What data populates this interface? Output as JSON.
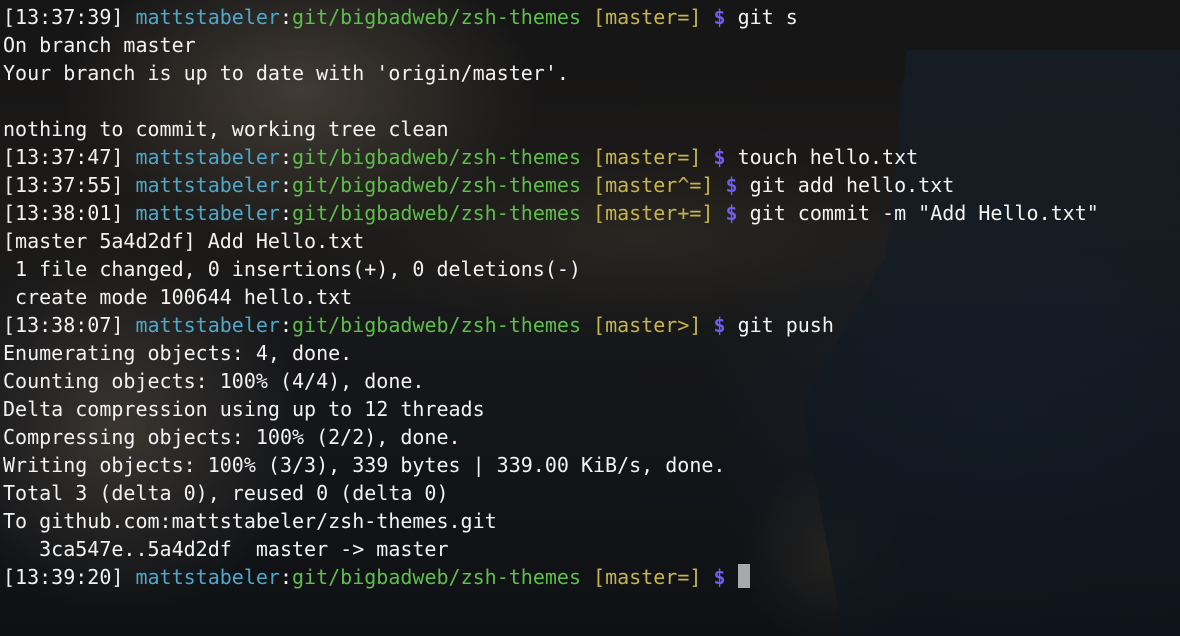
{
  "colors": {
    "username": "#4fa7c9",
    "path": "#5dbf4a",
    "branch": "#c7b44a",
    "prompt_symbol": "#6f5cf0",
    "text": "#f2f2f2",
    "cursor": "#a9a9a9"
  },
  "lines": [
    {
      "type": "prompt",
      "time": "[13:37:39]",
      "user": "mattstabeler",
      "sep": ":",
      "path": "git/bigbadweb/zsh-themes",
      "branch": "[master=]",
      "symbol": "$",
      "command": "git s"
    },
    {
      "type": "output",
      "text": "On branch master"
    },
    {
      "type": "output",
      "text": "Your branch is up to date with 'origin/master'."
    },
    {
      "type": "output",
      "text": ""
    },
    {
      "type": "output",
      "text": "nothing to commit, working tree clean"
    },
    {
      "type": "prompt",
      "time": "[13:37:47]",
      "user": "mattstabeler",
      "sep": ":",
      "path": "git/bigbadweb/zsh-themes",
      "branch": "[master=]",
      "symbol": "$",
      "command": "touch hello.txt"
    },
    {
      "type": "prompt",
      "time": "[13:37:55]",
      "user": "mattstabeler",
      "sep": ":",
      "path": "git/bigbadweb/zsh-themes",
      "branch": "[master^=]",
      "symbol": "$",
      "command": "git add hello.txt"
    },
    {
      "type": "prompt",
      "time": "[13:38:01]",
      "user": "mattstabeler",
      "sep": ":",
      "path": "git/bigbadweb/zsh-themes",
      "branch": "[master+=]",
      "symbol": "$",
      "command": "git commit -m \"Add Hello.txt\""
    },
    {
      "type": "output",
      "text": "[master 5a4d2df] Add Hello.txt"
    },
    {
      "type": "output",
      "text": " 1 file changed, 0 insertions(+), 0 deletions(-)"
    },
    {
      "type": "output",
      "text": " create mode 100644 hello.txt"
    },
    {
      "type": "prompt",
      "time": "[13:38:07]",
      "user": "mattstabeler",
      "sep": ":",
      "path": "git/bigbadweb/zsh-themes",
      "branch": "[master>]",
      "symbol": "$",
      "command": "git push"
    },
    {
      "type": "output",
      "text": "Enumerating objects: 4, done."
    },
    {
      "type": "output",
      "text": "Counting objects: 100% (4/4), done."
    },
    {
      "type": "output",
      "text": "Delta compression using up to 12 threads"
    },
    {
      "type": "output",
      "text": "Compressing objects: 100% (2/2), done."
    },
    {
      "type": "output",
      "text": "Writing objects: 100% (3/3), 339 bytes | 339.00 KiB/s, done."
    },
    {
      "type": "output",
      "text": "Total 3 (delta 0), reused 0 (delta 0)"
    },
    {
      "type": "output",
      "text": "To github.com:mattstabeler/zsh-themes.git"
    },
    {
      "type": "output",
      "text": "   3ca547e..5a4d2df  master -> master"
    },
    {
      "type": "prompt",
      "time": "[13:39:20]",
      "user": "mattstabeler",
      "sep": ":",
      "path": "git/bigbadweb/zsh-themes",
      "branch": "[master=]",
      "symbol": "$",
      "command": "",
      "cursor": true
    }
  ]
}
